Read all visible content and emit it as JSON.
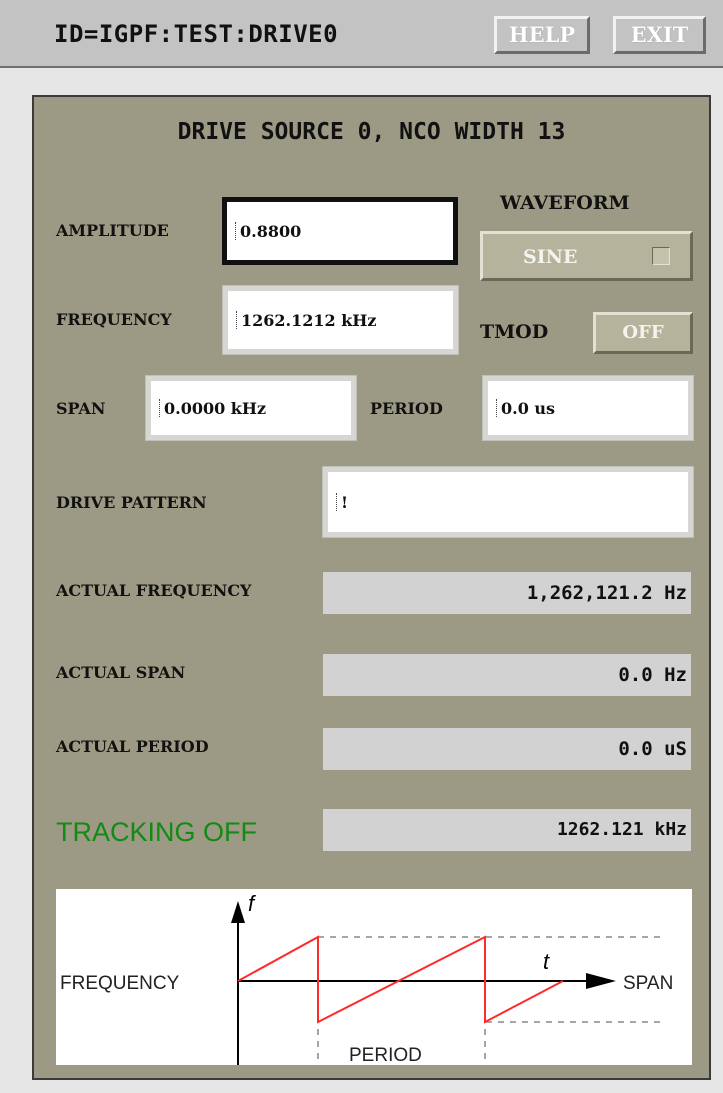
{
  "titlebar": {
    "record_id": "ID=IGPF:TEST:DRIVE0",
    "help_label": "HELP",
    "exit_label": "EXIT"
  },
  "panel": {
    "header": "DRIVE SOURCE 0, NCO WIDTH 13",
    "amplitude": {
      "label": "AMPLITUDE",
      "value": "0.8800"
    },
    "waveform": {
      "label": "WAVEFORM",
      "value": "SINE"
    },
    "frequency": {
      "label": "FREQUENCY",
      "value": "1262.1212 kHz"
    },
    "tmod": {
      "label": "TMOD",
      "value": "OFF"
    },
    "span": {
      "label": "SPAN",
      "value": "0.0000 kHz"
    },
    "period": {
      "label": "PERIOD",
      "value": "0.0 us"
    },
    "drive_pattern": {
      "label": "DRIVE PATTERN",
      "value": "!"
    },
    "actual_frequency": {
      "label": "ACTUAL FREQUENCY",
      "value": "1,262,121.2 Hz"
    },
    "actual_span": {
      "label": "ACTUAL SPAN",
      "value": "0.0 Hz"
    },
    "actual_period": {
      "label": "ACTUAL PERIOD",
      "value": "0.0 uS"
    },
    "tracking": {
      "label": "TRACKING OFF",
      "value": "1262.121 kHz",
      "color": "#138a13"
    }
  },
  "diagram": {
    "f_label": "f",
    "t_label": "t",
    "frequency_label": "FREQUENCY",
    "span_label": "SPAN",
    "period_label": "PERIOD",
    "ramp_color": "#ff2a2a"
  },
  "colors": {
    "panel_bg": "#9c9a84",
    "window_bg": "#e6e6e6",
    "titlebar_bg": "#c3c3c3",
    "readout_bg": "#d2d2d2"
  }
}
